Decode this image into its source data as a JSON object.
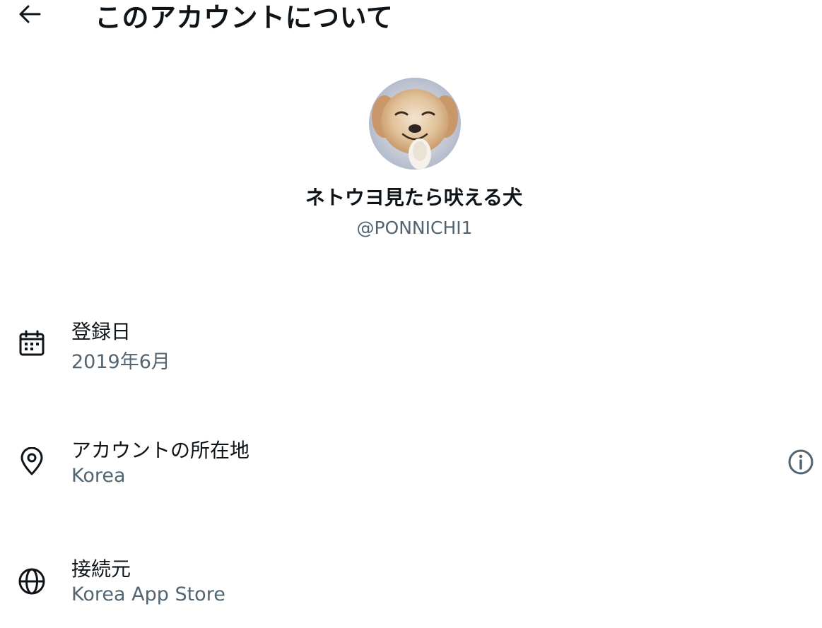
{
  "header": {
    "title": "このアカウントについて",
    "back_icon": "arrow-left-icon"
  },
  "profile": {
    "display_name": "ネトウヨ見たら吠える犬",
    "handle": "@PONNICHI1",
    "avatar": "dog-avatar-image"
  },
  "details": [
    {
      "label": "登録日",
      "value": "2019年6月",
      "icon": "calendar-icon"
    },
    {
      "label": "アカウントの所在地",
      "value": "Korea",
      "icon": "location-pin-icon",
      "trailing_icon": "info-icon"
    },
    {
      "label": "接続元",
      "value": "Korea App Store",
      "icon": "globe-icon"
    }
  ],
  "colors": {
    "text_primary": "#0f1419",
    "text_secondary": "#536471",
    "background": "#ffffff"
  }
}
